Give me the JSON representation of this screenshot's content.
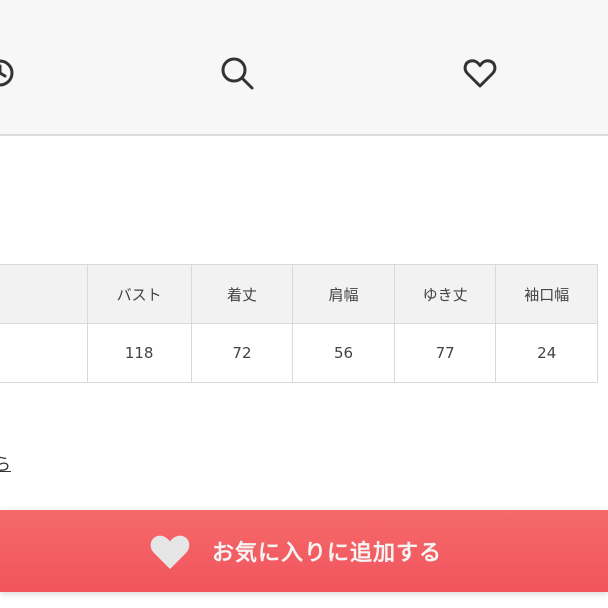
{
  "nav": {
    "icons": [
      "clock-icon",
      "search-icon",
      "heart-icon"
    ]
  },
  "size_table": {
    "headers": [
      "",
      "バスト",
      "着丈",
      "肩幅",
      "ゆき丈",
      "袖口幅"
    ],
    "row": [
      "",
      "118",
      "72",
      "56",
      "77",
      "24"
    ]
  },
  "partial_link": {
    "text": "ら"
  },
  "favorite_button": {
    "label": "お気に入りに追加する",
    "icon": "heart-icon"
  },
  "colors": {
    "accent": "#f15a62",
    "navbar_bg": "#f7f7f7",
    "table_header_bg": "#f2f2f2",
    "heart_fill": "#e6e6e6"
  }
}
